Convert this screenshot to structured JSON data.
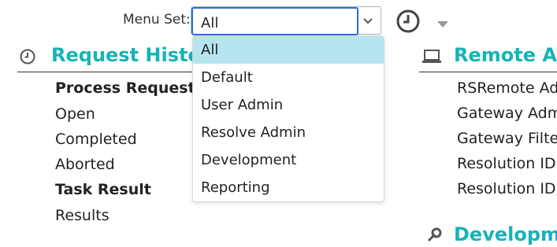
{
  "menu_set": {
    "label": "Menu Set:",
    "value": "All",
    "options": [
      "All",
      "Default",
      "User Admin",
      "Resolve Admin",
      "Development",
      "Reporting"
    ],
    "selected": "All"
  },
  "icons": {
    "history_clock": "clock-icon",
    "section_clock": "clock-icon",
    "remote": "laptop-icon",
    "development": "wrench-icon",
    "dropdown_toggle": "chevron-down-icon",
    "history_toggle": "caret-down-icon"
  },
  "sections": {
    "request_history": {
      "title": "Request Histor",
      "items": [
        {
          "label": "Process Request",
          "bold": true
        },
        {
          "label": "Open",
          "bold": false
        },
        {
          "label": "Completed",
          "bold": false
        },
        {
          "label": "Aborted",
          "bold": false
        },
        {
          "label": "Task Result",
          "bold": true
        },
        {
          "label": "Results",
          "bold": false
        }
      ]
    },
    "remote_admin": {
      "title": "Remote Ad",
      "items": [
        "RSRemote Adr",
        "Gateway Adm",
        "Gateway Filte",
        "Resolution ID",
        "Resolution ID"
      ]
    },
    "development": {
      "title": "Developme"
    }
  },
  "colors": {
    "accent": "#16b3b8",
    "focus_border": "#2f6fd6",
    "selected_option_bg": "#b6e5f0"
  }
}
